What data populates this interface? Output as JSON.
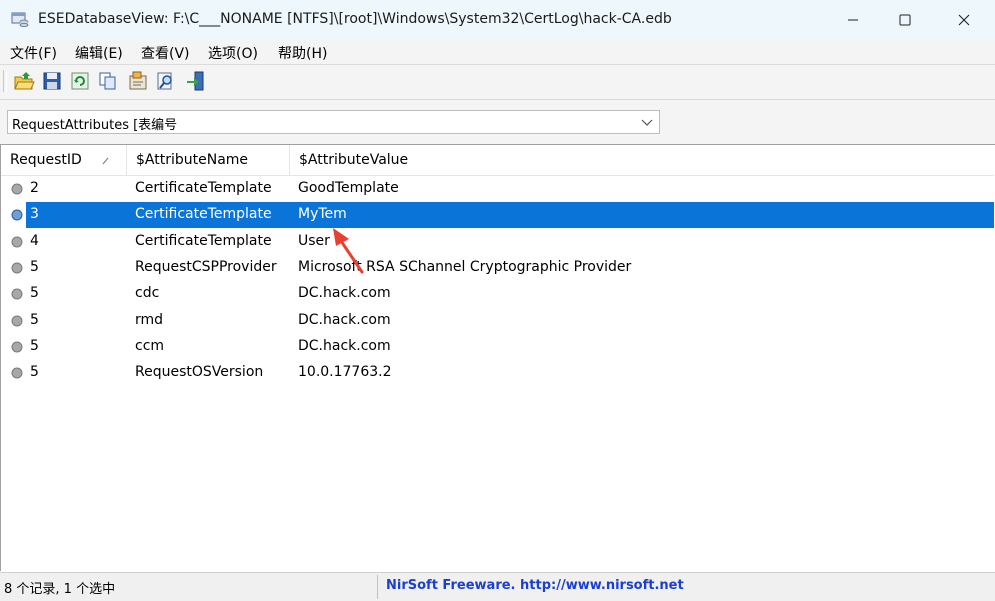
{
  "window": {
    "title": "ESEDatabaseView:   F:\\C___NONAME [NTFS]\\[root]\\Windows\\System32\\CertLog\\hack-CA.edb",
    "minimize_icon": "minimize-icon",
    "maximize_icon": "maximize-icon",
    "close_icon": "close-icon"
  },
  "menu": {
    "items": [
      "文件(F)",
      "编辑(E)",
      "查看(V)",
      "选项(O)",
      "帮助(H)"
    ]
  },
  "toolbar": {
    "icons": [
      "open-folder-icon",
      "save-icon",
      "refresh-icon",
      "copy-icon",
      "properties-icon",
      "find-icon",
      "exit-icon"
    ]
  },
  "table_select": {
    "value": "RequestAttributes   [表编号"
  },
  "list": {
    "columns": [
      "RequestID",
      "$AttributeName",
      "$AttributeValue"
    ],
    "rows": [
      {
        "id": "2",
        "name": "CertificateTemplate",
        "value": "GoodTemplate",
        "selected": false
      },
      {
        "id": "3",
        "name": "CertificateTemplate",
        "value": "MyTem",
        "selected": true
      },
      {
        "id": "4",
        "name": "CertificateTemplate",
        "value": "User",
        "selected": false
      },
      {
        "id": "5",
        "name": "RequestCSPProvider",
        "value": "Microsoft RSA SChannel Cryptographic Provider",
        "selected": false
      },
      {
        "id": "5",
        "name": "cdc",
        "value": "DC.hack.com",
        "selected": false
      },
      {
        "id": "5",
        "name": "rmd",
        "value": "DC.hack.com",
        "selected": false
      },
      {
        "id": "5",
        "name": "ccm",
        "value": "DC.hack.com",
        "selected": false
      },
      {
        "id": "5",
        "name": "RequestOSVersion",
        "value": "10.0.17763.2",
        "selected": false
      }
    ]
  },
  "status": {
    "left": "8 个记录,  1 个选中",
    "right": "NirSoft Freeware.  http://www.nirsoft.net"
  },
  "colors": {
    "selection": "#0b74d9",
    "annotation_arrow": "#e8412f",
    "link": "#1a3fd1"
  }
}
